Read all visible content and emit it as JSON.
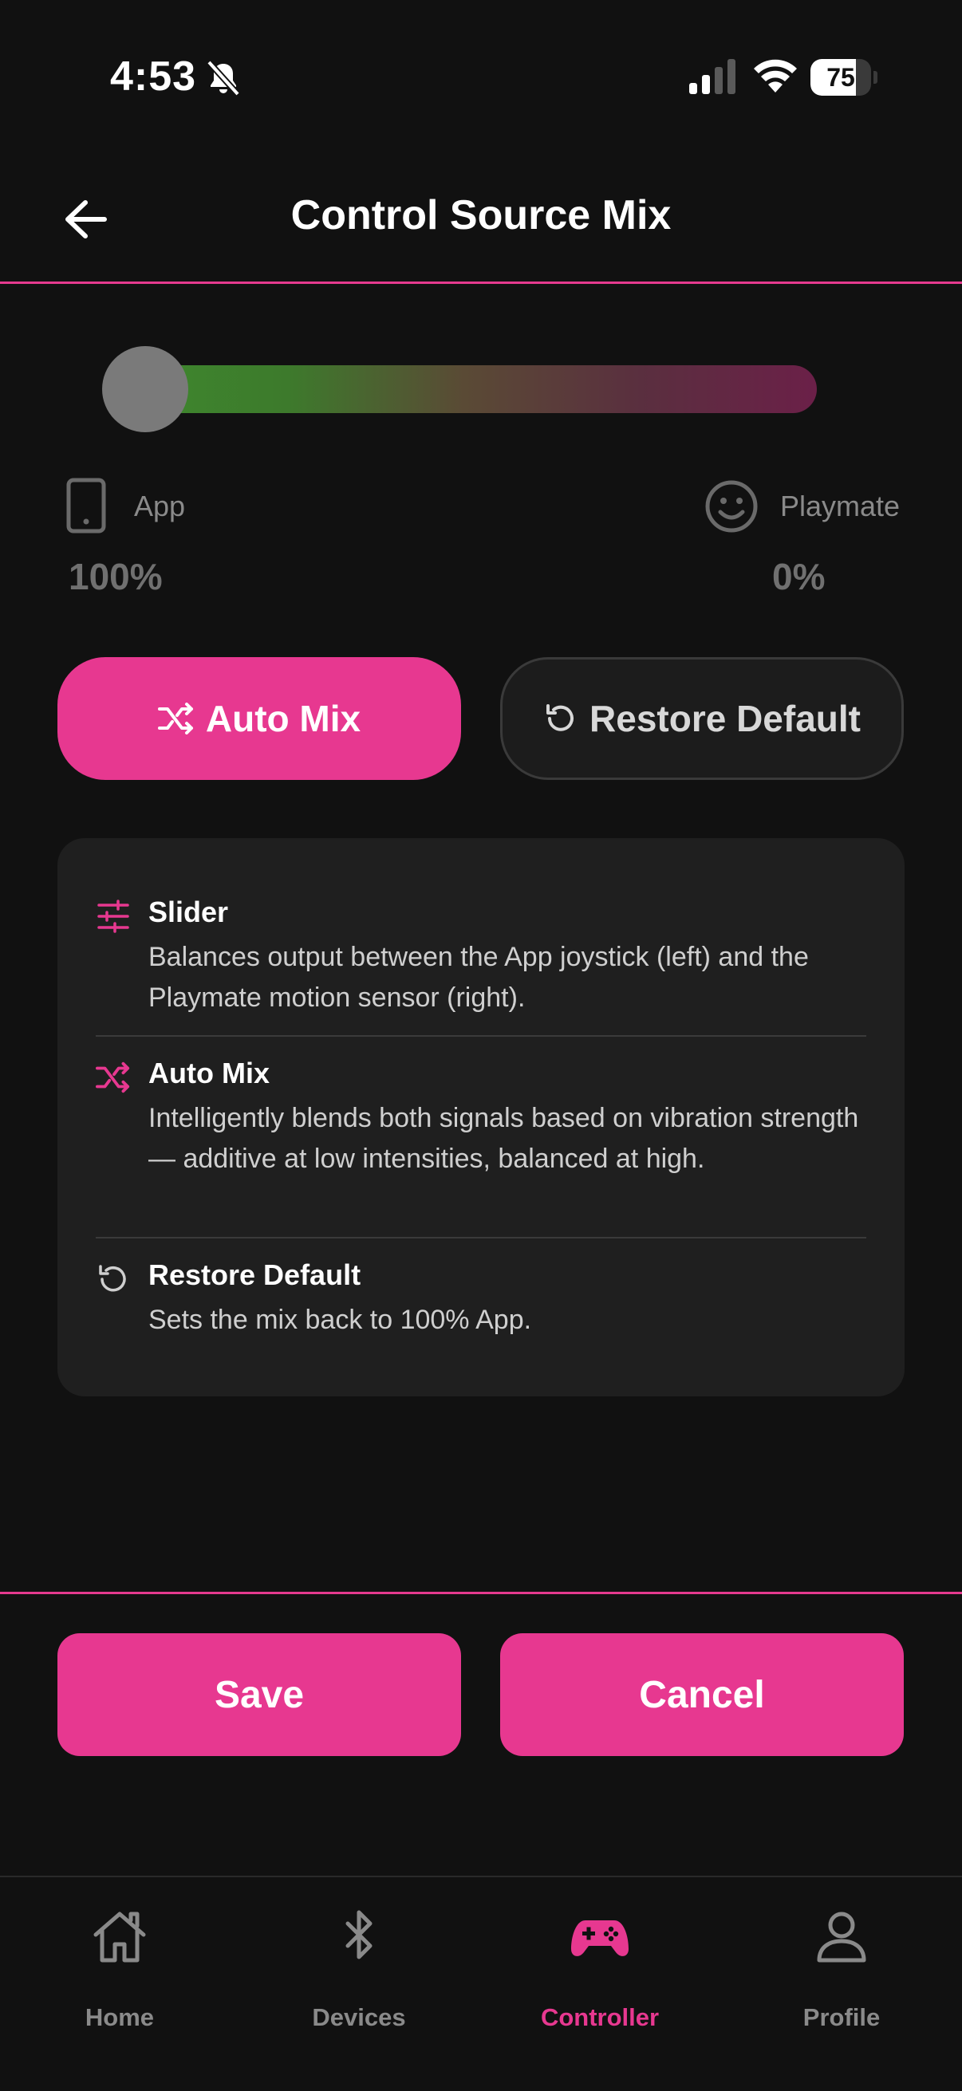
{
  "status_bar": {
    "time": "4:53",
    "battery": "75",
    "battery_level": 0.75
  },
  "header": {
    "title": "Control Source Mix"
  },
  "mix": {
    "level_playmate": 0.0,
    "app_label": "App",
    "app_value": "100%",
    "playmate_label": "Playmate",
    "playmate_value": "0%"
  },
  "actions": {
    "auto_mix": "Auto Mix",
    "restore_default": "Restore Default"
  },
  "info": [
    {
      "icon": "sliders-icon",
      "title": "Slider",
      "desc": "Balances output between the App joystick (left) and the Playmate motion sensor (right)."
    },
    {
      "icon": "shuffle-icon",
      "title": "Auto Mix",
      "desc": "Intelligently blends both signals based on vibration strength — additive at low intensities, balanced at high."
    },
    {
      "icon": "restore-icon",
      "title": "Restore Default",
      "desc": "Sets the mix back to 100% App."
    }
  ],
  "footer": {
    "save": "Save",
    "cancel": "Cancel"
  },
  "tabs": [
    {
      "label": "Home",
      "icon": "home-icon"
    },
    {
      "label": "Devices",
      "icon": "bluetooth-icon"
    },
    {
      "label": "Controller",
      "icon": "gamepad-icon",
      "active": true
    },
    {
      "label": "Profile",
      "icon": "profile-icon"
    }
  ],
  "colors": {
    "accent": "#e73890",
    "background": "#111111",
    "card": "#1f1f1f"
  }
}
